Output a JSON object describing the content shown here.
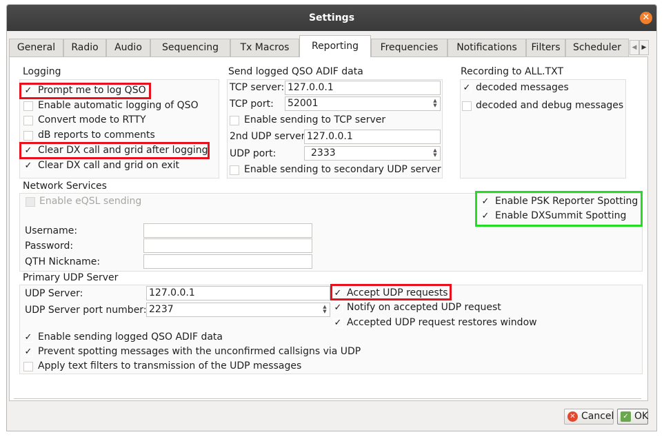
{
  "window": {
    "title": "Settings"
  },
  "tabs": [
    "General",
    "Radio",
    "Audio",
    "Sequencing",
    "Tx Macros",
    "Reporting",
    "Frequencies",
    "Notifications",
    "Filters",
    "Scheduler"
  ],
  "logging": {
    "title": "Logging",
    "prompt": "Prompt me to log QSO",
    "auto": "Enable automatic logging of QSO",
    "rtty": "Convert mode to RTTY",
    "db": "dB reports to comments",
    "clear_after": "Clear DX call and grid after logging",
    "clear_exit": "Clear DX call and grid on exit"
  },
  "adif": {
    "title": "Send logged QSO ADIF data",
    "tcp_server_label": "TCP server:",
    "tcp_server": "127.0.0.1",
    "tcp_port_label": "TCP port:",
    "tcp_port": "52001",
    "tcp_enable": "Enable sending to TCP server",
    "udp2_label": "2nd UDP server",
    "udp2": "127.0.0.1",
    "udp_port_label": "UDP port:",
    "udp_port": "2333",
    "udp2_enable": "Enable sending to secondary UDP server"
  },
  "recording": {
    "title": "Recording to ALL.TXT",
    "decoded": "decoded messages",
    "debug": "decoded and debug messages"
  },
  "network": {
    "title": "Network Services",
    "eqsl": "Enable eQSL sending",
    "psk": "Enable PSK Reporter Spotting",
    "dxsummit": "Enable DXSummit Spotting",
    "username_label": "Username:",
    "password_label": "Password:",
    "qth_label": "QTH Nickname:"
  },
  "udp": {
    "title": "Primary UDP Server",
    "server_label": "UDP Server:",
    "server": "127.0.0.1",
    "port_label": "UDP Server port number:",
    "port": "2237",
    "accept": "Accept UDP requests",
    "notify": "Notify on accepted UDP request",
    "restore": "Accepted UDP request restores window",
    "adif": "Enable sending logged QSO ADIF data",
    "prevent": "Prevent spotting messages with the unconfirmed callsigns via UDP",
    "filters": "Apply text filters to transmission of the UDP messages"
  },
  "buttons": {
    "cancel": "Cancel",
    "ok": "OK"
  },
  "colors": {
    "highlight_red": "#e8101a",
    "highlight_green": "#22dd22",
    "title_bar": "#3f3f3f"
  }
}
